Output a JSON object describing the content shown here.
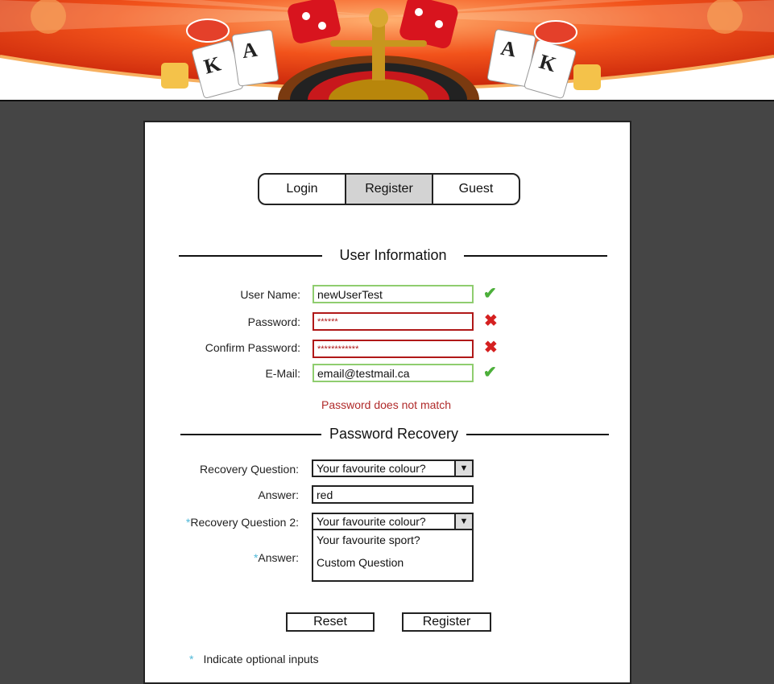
{
  "tabs": [
    {
      "label": "Login",
      "active": false
    },
    {
      "label": "Register",
      "active": true
    },
    {
      "label": "Guest",
      "active": false
    }
  ],
  "sections": {
    "user_info": "User Information",
    "recovery": "Password Recovery"
  },
  "fields": {
    "username": {
      "label": "User Name:",
      "value": "newUserTest",
      "status": "valid"
    },
    "password": {
      "label": "Password:",
      "value": "******",
      "status": "invalid"
    },
    "confirm_password": {
      "label": "Confirm Password:",
      "value": "************",
      "status": "invalid"
    },
    "email": {
      "label": "E-Mail:",
      "value": "email@testmail.ca",
      "status": "valid"
    }
  },
  "error_message": "Password does not match",
  "recovery": {
    "q1_label": "Recovery Question:",
    "q1_value": "Your favourite colour?",
    "a1_label": "Answer:",
    "a1_value": "red",
    "q2_label": "Recovery Question 2:",
    "q2_value": "Your favourite colour?",
    "q2_options_open": [
      "Your favourite sport?",
      "Custom Question"
    ],
    "a2_label": "Answer:"
  },
  "buttons": {
    "reset": "Reset",
    "register": "Register"
  },
  "optional_marker": "*",
  "optional_note": "Indicate optional inputs",
  "icons": {
    "valid": "check-icon",
    "invalid": "cross-icon",
    "dropdown": "triangle-down-icon"
  },
  "colors": {
    "valid": "#4caf3a",
    "invalid": "#d52020",
    "error_text": "#b02a2a",
    "optional": "#4fb8d8",
    "active_tab": "#d3d3d3"
  }
}
